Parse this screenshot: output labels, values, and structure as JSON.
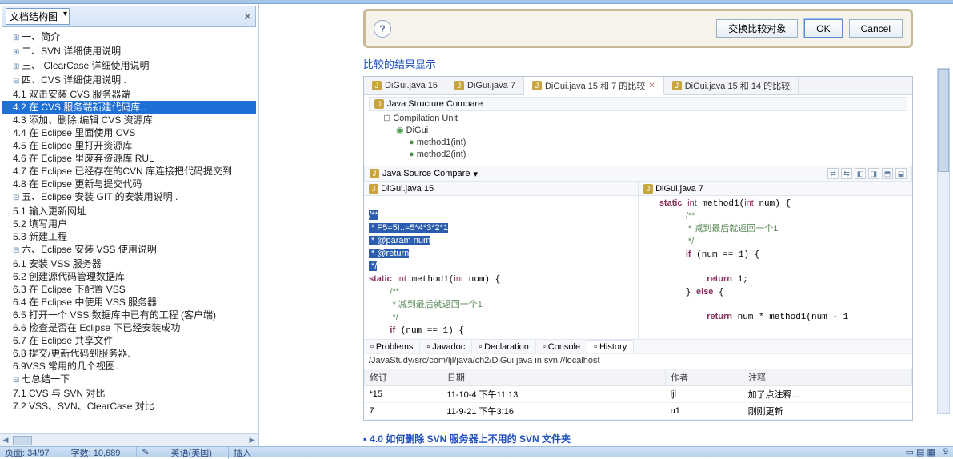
{
  "sidebar": {
    "combo_label": "文档结构图",
    "items": [
      {
        "label": "一、简介",
        "type": "node"
      },
      {
        "label": "二、SVN 详细使用说明",
        "type": "node"
      },
      {
        "label": "三、 ClearCase 详细使用说明",
        "type": "node"
      },
      {
        "label": "四、CVS 详细使用说明 .",
        "type": "node",
        "open": true,
        "children": [
          {
            "label": "4.1 双击安装 CVS 服务器端"
          },
          {
            "label": "4.2 在 CVS 服务端新建代码库..",
            "selected": true
          },
          {
            "label": "4.3 添加、删除.编辑 CVS 资源库"
          },
          {
            "label": "4.4 在 Eclipse 里面使用 CVS"
          },
          {
            "label": "4.5 在 Eclipse 里打开资源库"
          },
          {
            "label": "4.6 在 Eclipse 里废弃资源库 RUL"
          },
          {
            "label": "4.7 在 Eclipse 已经存在的CVN 库连接把代码提交到"
          },
          {
            "label": "4.8 在 Eclipse 更新与提交代码"
          }
        ]
      },
      {
        "label": "五、Eclipse 安装 GIT 的安装用说明 .",
        "type": "node",
        "open": true,
        "children": [
          {
            "label": "5.1 输入更新网址"
          },
          {
            "label": "5.2 填写用户"
          },
          {
            "label": "5.3 新建工程"
          }
        ]
      },
      {
        "label": "六、Eclipse 安装 VSS 使用说明",
        "type": "node",
        "open": true,
        "children": [
          {
            "label": "6.1 安装 VSS 服务器"
          },
          {
            "label": "6.2 创建源代码管理数据库"
          },
          {
            "label": "6.3 在 Eclipse 下配置 VSS"
          },
          {
            "label": "6.4 在 Eclipse 中使用 VSS 服务器"
          },
          {
            "label": "6.5 打开一个 VSS 数据库中已有的工程 (客户端)"
          },
          {
            "label": "6.6 检查是否在 Eclipse 下已经安装成功"
          },
          {
            "label": "6.7 在 Eclipse 共享文件"
          },
          {
            "label": "6.8 提交/更新代码到服务器."
          },
          {
            "label": "6.9VSS 常用的几个视图."
          }
        ]
      },
      {
        "label": "七总结一下",
        "type": "node",
        "open": true,
        "children": [
          {
            "label": "7.1 CVS 与 SVN 对比"
          },
          {
            "label": "7.2 VSS、SVN、ClearCase 对比"
          }
        ]
      }
    ]
  },
  "dialog": {
    "swap": "交换比较对象",
    "ok": "OK",
    "cancel": "Cancel"
  },
  "section": {
    "compare_result": "比较的结果显示"
  },
  "eclipse": {
    "tabs": [
      {
        "label": "DiGui.java 15"
      },
      {
        "label": "DiGui.java 7"
      },
      {
        "label": "DiGui.java 15 和 7 的比较",
        "active": true
      },
      {
        "label": "DiGui.java 15 和 14 的比较"
      }
    ],
    "struct_header": "Java Structure Compare",
    "struct": {
      "unit": "Compilation Unit",
      "cls": "DiGui",
      "methods": [
        "method1(int)",
        "method2(int)"
      ]
    },
    "src_header": "Java Source Compare",
    "left": {
      "title": "DiGui.java 15",
      "c1": "/**",
      "c2": " * F5=5!..=5*4*3*2*1",
      "c3": " * @param num",
      "c4": " * @return",
      "c5": " */",
      "sig": "static int method1(int num) {",
      "cc1": "/**",
      "cc2": " * 减到最后就返回一个1",
      "cc3": " */",
      "ifc": "if (num == 1) {"
    },
    "right": {
      "title": "DiGui.java 7",
      "sig": "static int method1(int num) {",
      "cc1": "/**",
      "cc2": " * 减到最后就返回一个1",
      "cc3": " */",
      "ifc": "if (num == 1) {",
      "ret1": "return 1;",
      "elsec": "} else {",
      "ret2": "return num * method1(num - 1"
    },
    "bottom_tabs": [
      "Problems",
      "Javadoc",
      "Declaration",
      "Console",
      "History"
    ],
    "path": "/JavaStudy/src/com/ljl/java/ch2/DiGui.java in svn://localhost",
    "cols": {
      "rev": "修订",
      "date": "日期",
      "author": "作者",
      "comment": "注释"
    },
    "rows": [
      {
        "rev": "*15",
        "date": "11-10-4 下午11:13",
        "author": "ljl",
        "comment": "加了点注释..."
      },
      {
        "rev": "7",
        "date": "11-9-21 下午3:16",
        "author": "u1",
        "comment": "刚刚更新"
      }
    ]
  },
  "footer_link": "4.0 如何删除 SVN 服务器上不用的 SVN 文件夹",
  "status": {
    "page": "页面: 34/97",
    "words": "字数: 10,689",
    "lang": "英语(美国)",
    "mode": "插入",
    "right": "9"
  }
}
